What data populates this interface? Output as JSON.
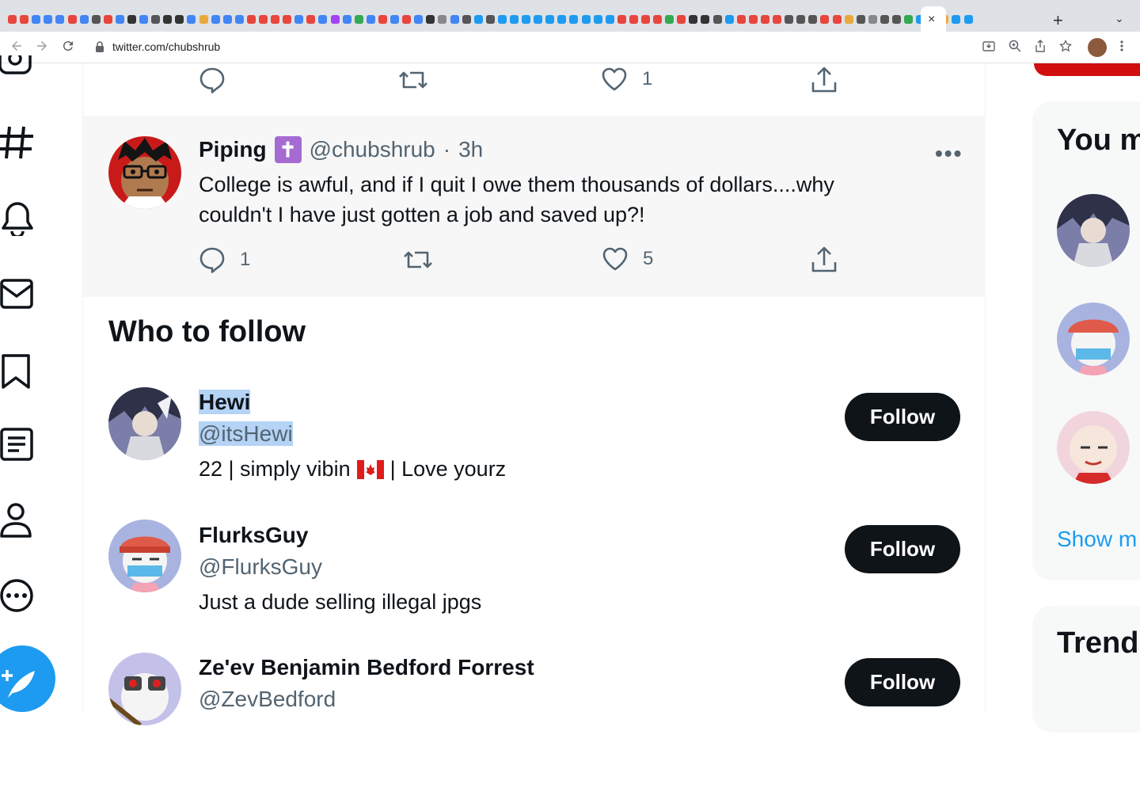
{
  "browser": {
    "url": "twitter.com/chubshrub",
    "tab_favicons": [
      "#e8453c",
      "#e8453c",
      "#4285f4",
      "#4285f4",
      "#4285f4",
      "#e8453c",
      "#4285f4",
      "#555",
      "#e8453c",
      "#4285f4",
      "#333",
      "#4285f4",
      "#555",
      "#333",
      "#333",
      "#4285f4",
      "#e8a93c",
      "#4285f4",
      "#4285f4",
      "#4285f4",
      "#e8453c",
      "#e8453c",
      "#e8453c",
      "#e8453c",
      "#4285f4",
      "#e8453c",
      "#4285f4",
      "#a142f4",
      "#4285f4",
      "#34a853",
      "#4285f4",
      "#e8453c",
      "#4285f4",
      "#e8453c",
      "#4285f4",
      "#333",
      "#888",
      "#4285f4",
      "#555",
      "#1d9bf0",
      "#555",
      "#1d9bf0",
      "#1d9bf0",
      "#1d9bf0",
      "#1d9bf0",
      "#1d9bf0",
      "#1d9bf0",
      "#1d9bf0",
      "#1d9bf0",
      "#1d9bf0",
      "#1d9bf0",
      "#e8453c",
      "#e8453c",
      "#e8453c",
      "#e8453c",
      "#34a853",
      "#e8453c",
      "#333",
      "#333",
      "#555",
      "#1d9bf0",
      "#e8453c",
      "#e8453c",
      "#e8453c",
      "#e8453c",
      "#555",
      "#555",
      "#555",
      "#e8453c",
      "#e8453c",
      "#e8a93c",
      "#555",
      "#888",
      "#555",
      "#555",
      "#34a853",
      "#1d9bf0",
      "#333",
      "#e8a93c",
      "#1d9bf0",
      "#1d9bf0"
    ],
    "active_tab_close": "×",
    "new_tab": "+",
    "tab_dropdown": "⌄"
  },
  "prev_tweet_actions": {
    "like_count": "1"
  },
  "tweet": {
    "name": "Piping",
    "badge": "✝",
    "handle": "@chubshrub",
    "separator": "·",
    "time": "3h",
    "text": "College is awful, and if I quit I owe them thousands of dollars....why couldn't I have just gotten a job and saved up?!",
    "reply_count": "1",
    "like_count": "5",
    "more": "•••"
  },
  "who_to_follow": {
    "title": "Who to follow",
    "users": [
      {
        "name": "Hewi",
        "handle": "@itsHewi",
        "bio_a": "22 | simply vibin",
        "flag": "🇨🇦",
        "bio_b": "| Love yourz",
        "follow_label": "Follow"
      },
      {
        "name": "FlurksGuy",
        "handle": "@FlurksGuy",
        "bio_a": "Just a dude selling illegal jpgs",
        "follow_label": "Follow"
      },
      {
        "name": "Ze'ev Benjamin Bedford Forrest",
        "handle": "@ZevBedford",
        "follow_label": "Follow"
      }
    ]
  },
  "right_column": {
    "you_might_like_title": "You m",
    "show_more": "Show m",
    "trends_title": "Trend"
  },
  "colors": {
    "twitter_blue": "#1d9bf0",
    "text": "#0f1419",
    "muted": "#536471",
    "selection": "#b4d3f5"
  }
}
